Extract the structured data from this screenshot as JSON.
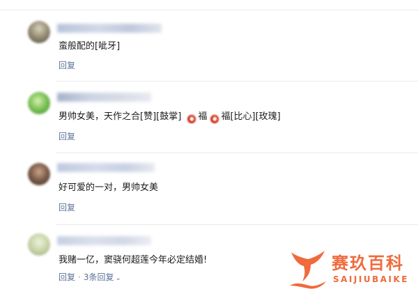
{
  "colors": {
    "link": "#5c7299",
    "accent": "#f06a3c",
    "divider": "#e9e9e9"
  },
  "comments": [
    {
      "text": "蛮般配的[呲牙]",
      "reply": "回复"
    },
    {
      "text_part1": "男帅女美，天作之合[赞][鼓掌] ",
      "badge_icon": "fu-emoji-icon",
      "fu1": "福",
      "fu2": "福",
      "text_part2": "[比心][玫瑰]",
      "reply": "回复"
    },
    {
      "text": "好可爱的一对，男帅女美",
      "reply": "回复"
    },
    {
      "text": "我赌一亿，窦骁何超莲今年必定结婚!",
      "reply": "回复",
      "more_replies": "3条回复"
    }
  ],
  "watermark": {
    "title": "赛玖百科",
    "subtitle": "SAIJIUBAIKE"
  }
}
